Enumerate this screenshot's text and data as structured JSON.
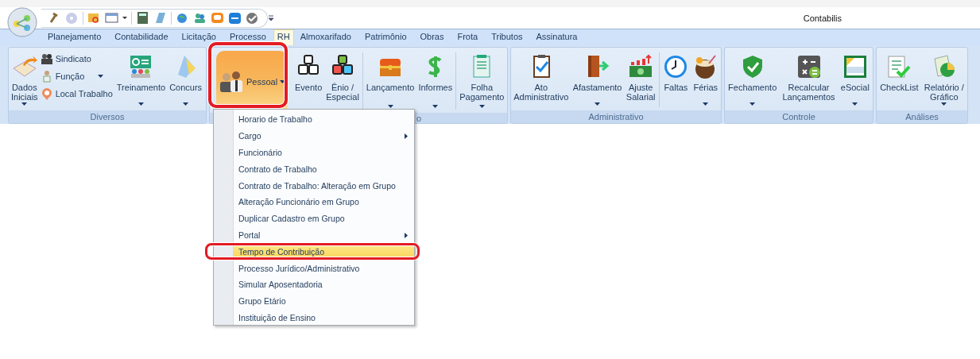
{
  "window": {
    "title": "Contabilis"
  },
  "tabs": [
    {
      "label": "Planejamento",
      "selected": false
    },
    {
      "label": "Contabilidade",
      "selected": false
    },
    {
      "label": "Licitação",
      "selected": false
    },
    {
      "label": "Processo",
      "selected": false
    },
    {
      "label": "RH",
      "selected": true
    },
    {
      "label": "Almoxarifado",
      "selected": false
    },
    {
      "label": "Patrimônio",
      "selected": false
    },
    {
      "label": "Obras",
      "selected": false
    },
    {
      "label": "Frota",
      "selected": false
    },
    {
      "label": "Tributos",
      "selected": false
    },
    {
      "label": "Assinatura",
      "selected": false
    }
  ],
  "ribbon": {
    "groups": [
      {
        "label": "Diversos",
        "buttons": [
          {
            "kind": "large",
            "label": "Dados\nIniciais",
            "dropdown": true
          },
          {
            "kind": "stack",
            "items": [
              {
                "label": "Sindicato",
                "dropdown": false
              },
              {
                "label": "Função",
                "dropdown": true
              },
              {
                "label": "Local Trabalho",
                "dropdown": false
              }
            ]
          },
          {
            "kind": "large",
            "label": "Treinamento",
            "dropdown": true
          },
          {
            "kind": "large",
            "label": "Concurs",
            "dropdown": true
          }
        ]
      },
      {
        "label": "o",
        "buttons": [
          {
            "kind": "split",
            "label": "Pessoal",
            "dropdown": true,
            "pressed": true,
            "annotated": true
          },
          {
            "kind": "large",
            "label": "Evento",
            "dropdown": false
          },
          {
            "kind": "large",
            "label": "Ênio /\nEspecial",
            "dropdown": false
          },
          {
            "kind": "separator"
          },
          {
            "kind": "large",
            "label": "Lançamento",
            "dropdown": true
          },
          {
            "kind": "large",
            "label": "Informes",
            "dropdown": true
          },
          {
            "kind": "separator"
          },
          {
            "kind": "large",
            "label": "Folha\nPagamento",
            "dropdown": true
          }
        ]
      },
      {
        "label": "Administrativo",
        "buttons": [
          {
            "kind": "large",
            "label": "Ato\nAdministrativo",
            "dropdown": false
          },
          {
            "kind": "large",
            "label": "Afastamento",
            "dropdown": true
          },
          {
            "kind": "large",
            "label": "Ajuste\nSalarial",
            "dropdown": false
          },
          {
            "kind": "separator"
          },
          {
            "kind": "large",
            "label": "Faltas",
            "dropdown": false
          },
          {
            "kind": "large",
            "label": "Férias",
            "dropdown": true
          }
        ]
      },
      {
        "label": "Controle",
        "buttons": [
          {
            "kind": "large",
            "label": "Fechamento",
            "dropdown": true
          },
          {
            "kind": "large",
            "label": "Recalcular\nLançamentos",
            "dropdown": false
          },
          {
            "kind": "large",
            "label": "eSocial",
            "dropdown": true
          }
        ]
      },
      {
        "label": "Análises",
        "buttons": [
          {
            "kind": "large",
            "label": "CheckList",
            "dropdown": false
          },
          {
            "kind": "large",
            "label": "Relatório /\nGráfico",
            "dropdown": true
          }
        ]
      }
    ]
  },
  "dropdown_menu": {
    "items": [
      {
        "label": "Horario de Trabalho",
        "submenu": false,
        "selected": false,
        "annotated": false
      },
      {
        "label": "Cargo",
        "submenu": true,
        "selected": false,
        "annotated": false
      },
      {
        "label": "Funcionário",
        "submenu": false,
        "selected": false,
        "annotated": false
      },
      {
        "label": "Contrato de Trabalho",
        "submenu": false,
        "selected": false,
        "annotated": false
      },
      {
        "label": "Contrato de Trabalho: Alteração em Grupo",
        "submenu": false,
        "selected": false,
        "annotated": false
      },
      {
        "label": "Alteração Funcionário em Grupo",
        "submenu": false,
        "selected": false,
        "annotated": false
      },
      {
        "label": "Duplicar Cadastro em Grupo",
        "submenu": false,
        "selected": false,
        "annotated": false
      },
      {
        "label": "Portal",
        "submenu": true,
        "selected": false,
        "annotated": false
      },
      {
        "label": "Tempo de Contribuição",
        "submenu": false,
        "selected": true,
        "annotated": true
      },
      {
        "label": "Processo Jurídico/Administrativo",
        "submenu": false,
        "selected": false,
        "annotated": false
      },
      {
        "label": "Simular Aposentadoria",
        "submenu": false,
        "selected": false,
        "annotated": false
      },
      {
        "label": "Grupo Etário",
        "submenu": false,
        "selected": false,
        "annotated": false
      },
      {
        "label": "Instituição de Ensino",
        "submenu": false,
        "selected": false,
        "annotated": false
      }
    ]
  }
}
